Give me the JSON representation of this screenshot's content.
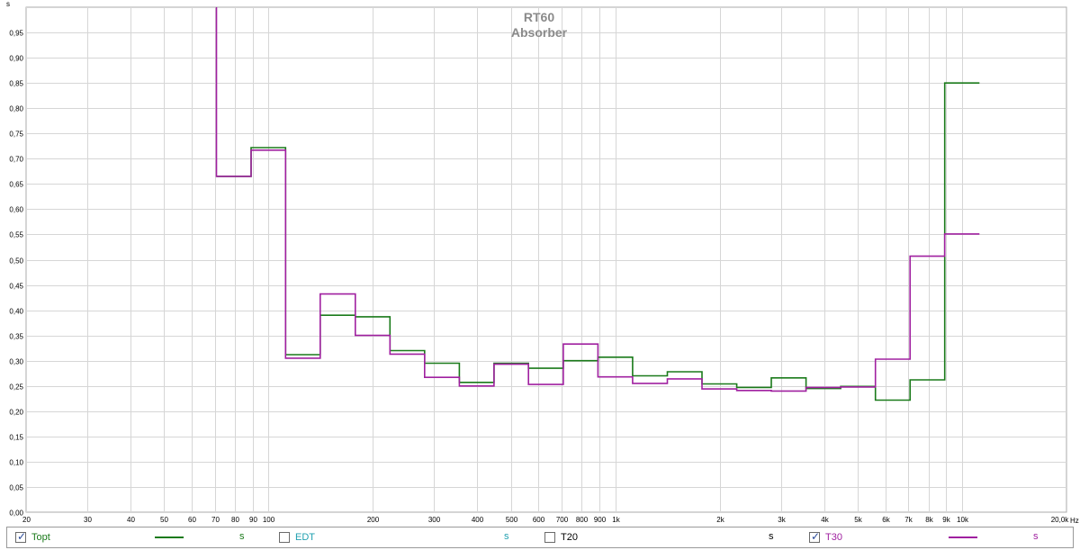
{
  "chart_data": {
    "type": "line",
    "title": "RT60",
    "subtitle": "Absorber",
    "ylabel": "s",
    "xlabel": "",
    "x_unit_label": "Hz",
    "x_scale": "log",
    "xlim": [
      20,
      20000
    ],
    "ylim": [
      0,
      1.0
    ],
    "grid": true,
    "x_ticks": [
      {
        "v": 20,
        "label": "20"
      },
      {
        "v": 30,
        "label": "30"
      },
      {
        "v": 40,
        "label": "40"
      },
      {
        "v": 50,
        "label": "50"
      },
      {
        "v": 60,
        "label": "60"
      },
      {
        "v": 70,
        "label": "70"
      },
      {
        "v": 80,
        "label": "80"
      },
      {
        "v": 90,
        "label": "90"
      },
      {
        "v": 100,
        "label": "100"
      },
      {
        "v": 200,
        "label": "200"
      },
      {
        "v": 300,
        "label": "300"
      },
      {
        "v": 400,
        "label": "400"
      },
      {
        "v": 500,
        "label": "500"
      },
      {
        "v": 600,
        "label": "600"
      },
      {
        "v": 700,
        "label": "700"
      },
      {
        "v": 800,
        "label": "800"
      },
      {
        "v": 900,
        "label": "900"
      },
      {
        "v": 1000,
        "label": "1k"
      },
      {
        "v": 2000,
        "label": "2k"
      },
      {
        "v": 3000,
        "label": "3k"
      },
      {
        "v": 4000,
        "label": "4k"
      },
      {
        "v": 5000,
        "label": "5k"
      },
      {
        "v": 6000,
        "label": "6k"
      },
      {
        "v": 7000,
        "label": "7k"
      },
      {
        "v": 8000,
        "label": "8k"
      },
      {
        "v": 9000,
        "label": "9k"
      },
      {
        "v": 10000,
        "label": "10k"
      },
      {
        "v": 20000,
        "label": "20,0k"
      }
    ],
    "y_ticks": [
      {
        "v": 0,
        "label": "0,00"
      },
      {
        "v": 0.05,
        "label": "0,05"
      },
      {
        "v": 0.1,
        "label": "0,10"
      },
      {
        "v": 0.15,
        "label": "0,15"
      },
      {
        "v": 0.2,
        "label": "0,20"
      },
      {
        "v": 0.25,
        "label": "0,25"
      },
      {
        "v": 0.3,
        "label": "0,30"
      },
      {
        "v": 0.35,
        "label": "0,35"
      },
      {
        "v": 0.4,
        "label": "0,40"
      },
      {
        "v": 0.45,
        "label": "0,45"
      },
      {
        "v": 0.5,
        "label": "0,50"
      },
      {
        "v": 0.55,
        "label": "0,55"
      },
      {
        "v": 0.6,
        "label": "0,60"
      },
      {
        "v": 0.65,
        "label": "0,65"
      },
      {
        "v": 0.7,
        "label": "0,70"
      },
      {
        "v": 0.75,
        "label": "0,75"
      },
      {
        "v": 0.8,
        "label": "0,80"
      },
      {
        "v": 0.85,
        "label": "0,85"
      },
      {
        "v": 0.9,
        "label": "0,90"
      },
      {
        "v": 0.95,
        "label": "0,95"
      }
    ],
    "series": [
      {
        "name": "Topt",
        "color": "#1a7a1a",
        "band_edges": [
          70.8,
          89.1,
          112,
          141,
          178,
          224,
          282,
          355,
          447,
          562,
          708,
          891,
          1122,
          1413,
          1778,
          2239,
          2818,
          3548,
          4467,
          5623,
          7079,
          8913,
          11220
        ],
        "values": [
          0.665,
          0.722,
          0.312,
          0.39,
          0.387,
          0.32,
          0.295,
          0.257,
          0.295,
          0.285,
          0.3,
          0.307,
          0.27,
          0.278,
          0.254,
          0.247,
          0.266,
          0.245,
          0.249,
          0.222,
          0.262,
          0.85
        ]
      },
      {
        "name": "T30",
        "color": "#a020a0",
        "band_edges": [
          70.8,
          89.1,
          112,
          141,
          178,
          224,
          282,
          355,
          447,
          562,
          708,
          891,
          1122,
          1413,
          1778,
          2239,
          2818,
          3548,
          4467,
          5623,
          7079,
          8913,
          11220
        ],
        "values": [
          0.665,
          0.717,
          0.305,
          0.432,
          0.35,
          0.313,
          0.267,
          0.25,
          0.293,
          0.253,
          0.333,
          0.268,
          0.255,
          0.264,
          0.244,
          0.241,
          0.24,
          0.247,
          0.248,
          0.303,
          0.507,
          0.551
        ],
        "start_from": 1.0
      }
    ]
  },
  "legend": {
    "items": [
      {
        "label": "Topt",
        "checked": true,
        "color": "#1a7a1a",
        "text_color": "#1a7a1a",
        "line": true,
        "unit": "s",
        "unit_color": "#1a7a1a"
      },
      {
        "label": "EDT",
        "checked": false,
        "color": "#20a0b0",
        "text_color": "#20a0b0",
        "line": false,
        "unit": "s",
        "unit_color": "#20a0b0"
      },
      {
        "label": "T20",
        "checked": false,
        "color": "#000000",
        "text_color": "#000000",
        "line": false,
        "unit": "s",
        "unit_color": "#000000"
      },
      {
        "label": "T30",
        "checked": true,
        "color": "#a020a0",
        "text_color": "#a020a0",
        "line": true,
        "unit": "s",
        "unit_color": "#a020a0"
      }
    ]
  }
}
